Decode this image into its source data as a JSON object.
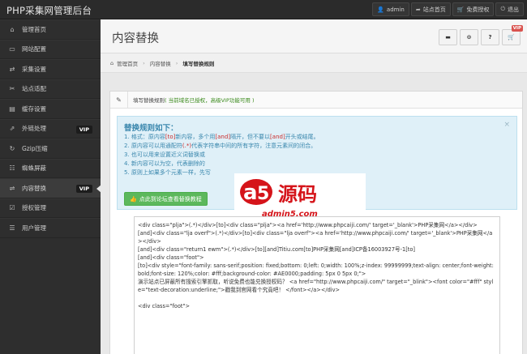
{
  "topbar": {
    "brand": "PHP采集网管理后台",
    "actions": [
      {
        "icon": "user-icon",
        "glyph": "👤",
        "label": "admin"
      },
      {
        "icon": "share-icon",
        "glyph": "➦",
        "label": "站点首页"
      },
      {
        "icon": "cart-icon",
        "glyph": "🛒",
        "label": "免费授权"
      },
      {
        "icon": "logout-icon",
        "glyph": "⏻",
        "label": "退出"
      }
    ]
  },
  "sidebar": {
    "items": [
      {
        "icon": "home-icon",
        "glyph": "⌂",
        "label": "管理首页",
        "vip": ""
      },
      {
        "icon": "config-icon",
        "glyph": "▭",
        "label": "网站配置",
        "vip": ""
      },
      {
        "icon": "collect-icon",
        "glyph": "⇄",
        "label": "采集设置",
        "vip": ""
      },
      {
        "icon": "adapt-icon",
        "glyph": "✂",
        "label": "站点适配",
        "vip": ""
      },
      {
        "icon": "cache-icon",
        "glyph": "▤",
        "label": "缓存设置",
        "vip": ""
      },
      {
        "icon": "link-icon",
        "glyph": "⇗",
        "label": "外链处理",
        "vip": "VIP"
      },
      {
        "icon": "gzip-icon",
        "glyph": "↻",
        "label": "Gzip压缩",
        "vip": ""
      },
      {
        "icon": "spider-icon",
        "glyph": "☷",
        "label": "蜘蛛屏蔽",
        "vip": ""
      },
      {
        "icon": "replace-icon",
        "glyph": "⇌",
        "label": "内容替换",
        "vip": "VIP"
      },
      {
        "icon": "license-icon",
        "glyph": "☑",
        "label": "授权管理",
        "vip": ""
      },
      {
        "icon": "users-icon",
        "glyph": "☰",
        "label": "用户管理",
        "vip": ""
      }
    ]
  },
  "page": {
    "title": "内容替换",
    "head_buttons": [
      "▬",
      "⊙",
      "?",
      "🛒"
    ],
    "vip_badge": "VIP"
  },
  "breadcrumb": {
    "home": "管理首页",
    "section": "内容替换",
    "current": "填写替换规则"
  },
  "panel": {
    "title": "填写替换规则",
    "note": "( 当前域名已授权，高级VIP功能可用 )"
  },
  "alert": {
    "title": "替换规则如下：",
    "close": "×",
    "rule1_a": "1. 格式：原内容",
    "rule1_b": "[to]",
    "rule1_c": "新内容，多个用",
    "rule1_d": "[and]",
    "rule1_e": "隔开，但不要以",
    "rule1_f": "[and]",
    "rule1_g": "开头或结尾。",
    "rule2_a": "2. 原内容可以用通配符",
    "rule2_b": "(.*)",
    "rule2_c": "代表字符串中间的所有字符，注意元素间的闭合。",
    "rule3": "3. 也可以用来设置近义词替换或",
    "rule4": "4. 新内容可以为空，代表删除的",
    "rule5": "5. 原则上如果多个元素一样，先写",
    "button": "点此到论坛查看替换教程"
  },
  "watermark": {
    "cn": "源码",
    "url": "admin5.com"
  },
  "code": {
    "lines": [
      "<div class=\"plja\">(.*)</div>[to]<div class=\"plja\"><a href='http://www.phpcaiji.com/' target='_blank'>PHP采集网</a></div>",
      "[and]<div class=\"lja overf\">(.*)</div>[to]<div class=\"lja overf\"><a href='http://www.phpcaiji.com/' target='_blank'>PHP采集网</a></div>",
      "[and]<div class=\"return1 ewm\">(.*)</div>[to][and]Titiu.com[to]PHP采集网[and]ICP备16003927号-1[to]",
      "[and]<div class=\"foot\">",
      "[to]<div style=\"font-family: sans-serif;position: fixed;bottom: 0;left: 0;width: 100%;z-index: 99999999;text-align: center;font-weight: bold;font-size: 120%;color: #fff;background-color: #AE0000;padding: 5px 0 5px 0;\">",
      "演示站点已屏蔽所有搜索引擎抓取，听说免费也能兑换授权码？ <a href=\"http://www.phpcaiji.com/\" target=\"_blink\"><font color=\"#fff\" style=\"text-decoration:underline;\">戳我到官网看个究竟吧！ </font></a></div>",
      "",
      "<div class=\"foot\">"
    ]
  }
}
